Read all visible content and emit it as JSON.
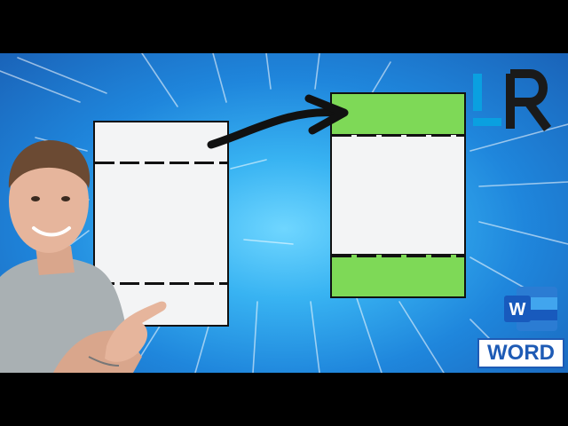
{
  "thumbnail": {
    "logo_text": "LR",
    "word_label": "WORD",
    "word_tile_letter": "W",
    "colors": {
      "background": "#2a9ae8",
      "header_highlight": "#7ed957",
      "page": "#f3f4f5",
      "word_blue": "#1e5bb5"
    },
    "icons": [
      "lr-logo-icon",
      "word-logo-icon",
      "arrow-icon"
    ]
  }
}
